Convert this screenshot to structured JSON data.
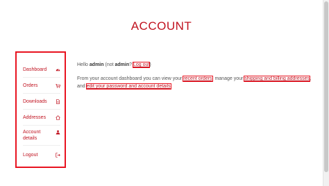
{
  "page": {
    "title": "ACCOUNT"
  },
  "sidebar": {
    "items": [
      {
        "label": "Dashboard",
        "icon": "gauge-icon",
        "active": true
      },
      {
        "label": "Orders",
        "icon": "cart-icon"
      },
      {
        "label": "Downloads",
        "icon": "file-icon"
      },
      {
        "label": "Addresses",
        "icon": "home-icon"
      },
      {
        "label": "Account details",
        "icon": "user-icon"
      },
      {
        "label": "Logout",
        "icon": "logout-icon"
      }
    ]
  },
  "greeting": {
    "hello": "Hello",
    "username": "admin",
    "not_prefix": "(not",
    "username_again": "admin",
    "question": "?",
    "logout_link": "Log out",
    "close_paren": ")"
  },
  "description": {
    "part1": "From your account dashboard you can view your",
    "link_recent_orders": "recent orders",
    "part2": ", manage your",
    "link_addresses": "shipping and billing addresses",
    "part3": ", and",
    "link_account": "edit your password and account details",
    "part4": "."
  },
  "colors": {
    "accent": "#c0121f",
    "highlight_border": "#e8121f"
  }
}
